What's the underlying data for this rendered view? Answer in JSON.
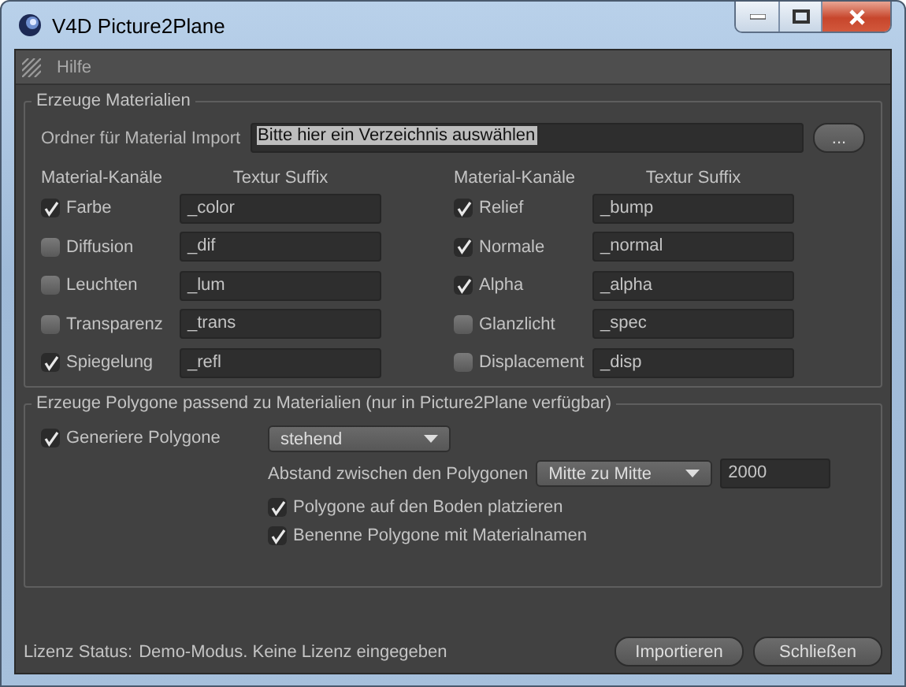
{
  "window": {
    "title": "V4D Picture2Plane"
  },
  "menu": [
    {
      "label": "Hilfe"
    }
  ],
  "materials": {
    "title": "Erzeuge Materialien",
    "folder_label": "Ordner für Material Import",
    "folder_value": "Bitte hier ein Verzeichnis auswählen",
    "browse_button": "...",
    "columns": [
      {
        "channel_header": "Material-Kanäle",
        "suffix_header": "Textur Suffix",
        "channels": [
          {
            "name": "Farbe",
            "checked": true,
            "suffix": "_color"
          },
          {
            "name": "Diffusion",
            "checked": false,
            "suffix": "_dif"
          },
          {
            "name": "Leuchten",
            "checked": false,
            "suffix": "_lum"
          },
          {
            "name": "Transparenz",
            "checked": false,
            "suffix": "_trans"
          },
          {
            "name": "Spiegelung",
            "checked": true,
            "suffix": "_refl"
          }
        ]
      },
      {
        "channel_header": "Material-Kanäle",
        "suffix_header": "Textur Suffix",
        "channels": [
          {
            "name": "Relief",
            "checked": true,
            "suffix": "_bump"
          },
          {
            "name": "Normale",
            "checked": true,
            "suffix": "_normal"
          },
          {
            "name": "Alpha",
            "checked": true,
            "suffix": "_alpha"
          },
          {
            "name": "Glanzlicht",
            "checked": false,
            "suffix": "_spec"
          },
          {
            "name": "Displacement",
            "checked": false,
            "suffix": "_disp"
          }
        ]
      }
    ]
  },
  "polygons": {
    "title": "Erzeuge Polygone passend zu Materialien (nur in Picture2Plane verfügbar)",
    "generate": {
      "label": "Generiere Polygone",
      "checked": true
    },
    "orientation": "stehend",
    "distance_label": "Abstand zwischen den Polygonen",
    "distance_mode": "Mitte zu Mitte",
    "distance_value": "2000",
    "options": [
      {
        "label": "Polygone auf den Boden platzieren",
        "checked": true
      },
      {
        "label": "Benenne Polygone mit Materialnamen",
        "checked": true
      }
    ]
  },
  "status": {
    "label": "Lizenz Status:",
    "text": "Demo-Modus. Keine Lizenz eingegeben"
  },
  "buttons": [
    "Importieren",
    "Schließen"
  ]
}
